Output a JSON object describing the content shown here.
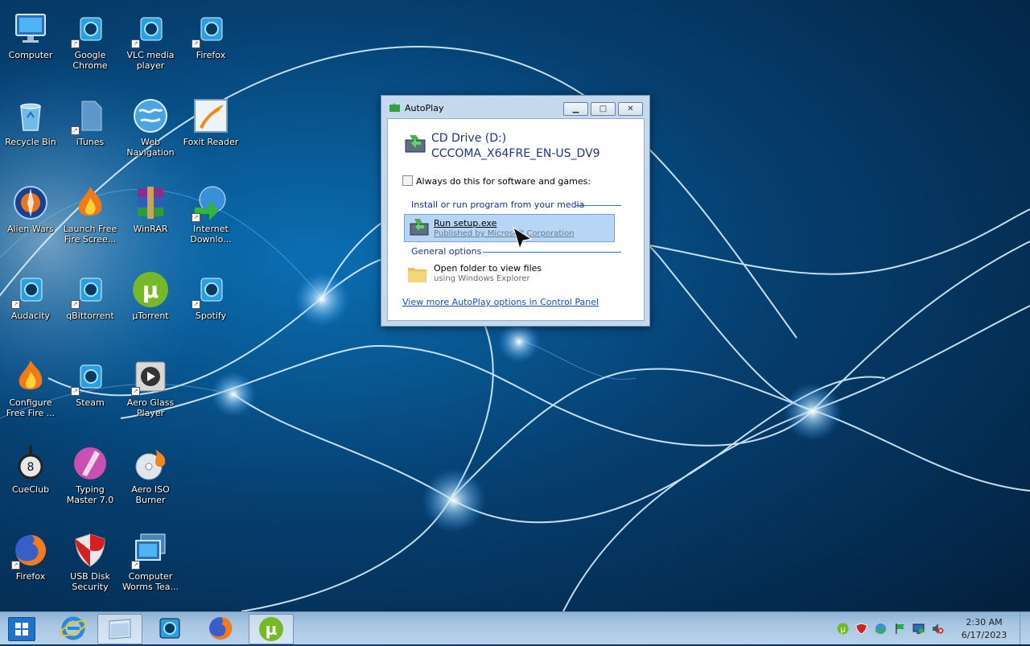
{
  "desktop": {
    "icons": [
      {
        "label": "Computer",
        "icon": "computer-icon"
      },
      {
        "label": "Google Chrome",
        "icon": "app-icon"
      },
      {
        "label": "VLC media player",
        "icon": "app-icon"
      },
      {
        "label": "Firefox",
        "icon": "app-icon"
      },
      {
        "label": "Recycle Bin",
        "icon": "recycle-bin-icon"
      },
      {
        "label": "iTunes",
        "icon": "file-icon"
      },
      {
        "label": "Web Navigation",
        "icon": "globe-icon"
      },
      {
        "label": "Foxit Reader",
        "icon": "foxit-reader-icon"
      },
      {
        "label": "Alien Wars",
        "icon": "alien-wars-icon"
      },
      {
        "label": "Launch Free Fire Scree...",
        "icon": "free-fire-icon"
      },
      {
        "label": "WinRAR",
        "icon": "winrar-icon"
      },
      {
        "label": "Internet Downlo...",
        "icon": "internet-download-icon"
      },
      {
        "label": "Audacity",
        "icon": "app-icon"
      },
      {
        "label": "qBittorrent",
        "icon": "app-icon"
      },
      {
        "label": "µTorrent",
        "icon": "utorrent-icon"
      },
      {
        "label": "Spotify",
        "icon": "app-icon"
      },
      {
        "label": "Configure Free Fire ...",
        "icon": "free-fire-icon"
      },
      {
        "label": "Steam",
        "icon": "app-icon"
      },
      {
        "label": "Aero Glass Player",
        "icon": "media-player-icon"
      },
      {
        "label": "CueClub",
        "icon": "cueclub-icon"
      },
      {
        "label": "Typing Master 7.0",
        "icon": "typing-master-icon"
      },
      {
        "label": "Aero ISO Burner",
        "icon": "disc-burner-icon"
      },
      {
        "label": "Firefox",
        "icon": "firefox-icon"
      },
      {
        "label": "USB Disk Security",
        "icon": "shield-icon"
      },
      {
        "label": "Computer Worms Tea...",
        "icon": "computer-icon"
      }
    ]
  },
  "autoplay": {
    "title": "AutoPlay",
    "drive_name": "CD Drive (D:)",
    "volume_label": "CCCOMA_X64FRE_EN-US_DV9",
    "always_checkbox_label": "Always do this for software and games:",
    "always_checked": false,
    "section_install": "Install or run program from your media",
    "run_title": "Run setup.exe",
    "run_publisher": "Published by Microsoft Corporation",
    "section_general": "General options",
    "folder_title": "Open folder to view files",
    "folder_subtitle": "using Windows Explorer",
    "control_panel_link": "View more AutoPlay options in Control Panel"
  },
  "taskbar": {
    "pinned": [
      "internet-explorer-icon",
      "file-explorer-icon",
      "media-player-icon",
      "firefox-icon",
      "utorrent-icon"
    ],
    "tray_icons": [
      "utorrent-tray-icon",
      "shield-tray-icon",
      "network-globe-icon",
      "action-center-flag-icon",
      "display-icon",
      "volume-muted-icon"
    ],
    "clock_time": "2:30 AM",
    "clock_date": "6/17/2023"
  },
  "colors": {
    "accent": "#1e3287",
    "link": "#1b4fb4",
    "selection": "#b7d6f5"
  }
}
